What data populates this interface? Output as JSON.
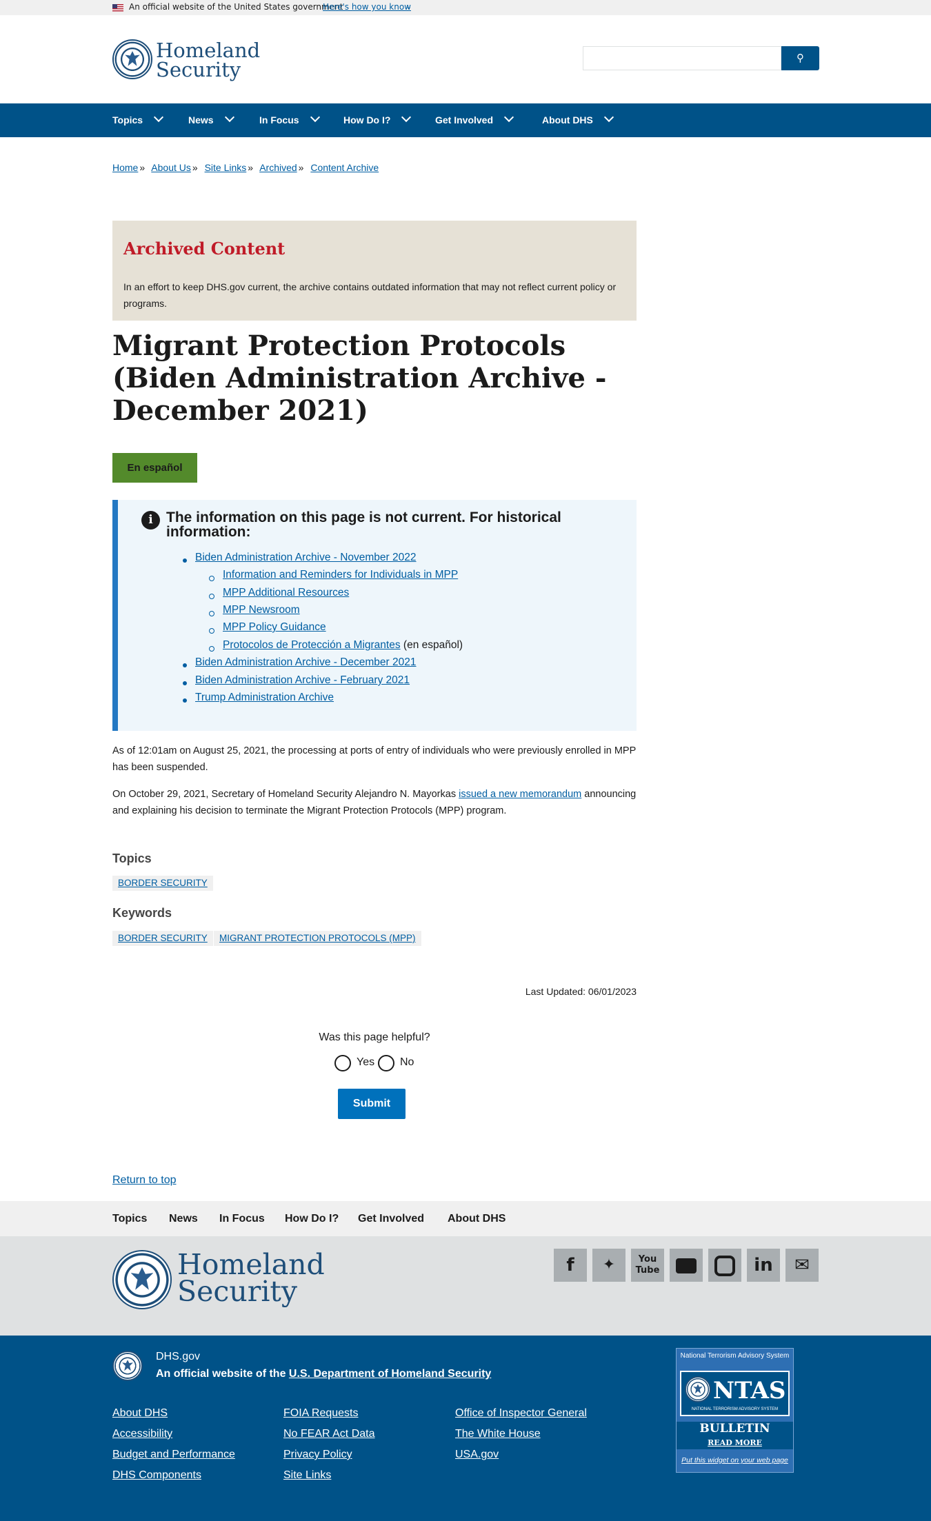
{
  "gov_banner": {
    "text": "An official website of the United States government",
    "link": "Here's how you know"
  },
  "logo": {
    "line1": "Homeland",
    "line2": "Security"
  },
  "search": {
    "placeholder": ""
  },
  "nav": [
    "Topics",
    "News",
    "In Focus",
    "How Do I?",
    "Get Involved",
    "About DHS"
  ],
  "breadcrumbs": [
    "Home",
    "About Us",
    "Site Links",
    "Archived",
    "Content Archive"
  ],
  "archived": {
    "title": "Archived Content",
    "text": "In an effort to keep DHS.gov current, the archive contains outdated information that may not reflect current policy or programs."
  },
  "page_title": "Migrant Protection Protocols (Biden Administration Archive - December 2021)",
  "espanol_button": "En español",
  "info_box": {
    "heading": "The information on this page is not current.  For historical information:",
    "items": [
      "Biden Administration Archive - November 2022",
      "Information and Reminders for Individuals in MPP",
      "MPP Additional Resources",
      "MPP Newsroom",
      "MPP Policy Guidance",
      "Protocolos de Protección a Migrantes",
      "(en español)",
      "Biden Administration Archive - December 2021",
      "Biden Administration Archive - February 2021",
      "Trump Administration Archive"
    ]
  },
  "body": {
    "p1": "As of 12:01am on August 25, 2021, the processing at ports of entry of individuals who were previously enrolled in MPP has been suspended.",
    "p2_a": "On October 29, 2021, Secretary of Homeland Security Alejandro N. Mayorkas ",
    "p2_link": "issued a new memorandum",
    "p2_b": " announcing and explaining his decision to terminate the Migrant Protection Protocols (MPP) program."
  },
  "topics": {
    "heading": "Topics",
    "tags": [
      "BORDER SECURITY"
    ]
  },
  "keywords": {
    "heading": "Keywords",
    "tags": [
      "BORDER SECURITY",
      "MIGRANT PROTECTION PROTOCOLS (MPP)"
    ]
  },
  "last_updated": "Last Updated: 06/01/2023",
  "feedback": {
    "question": "Was this page helpful?",
    "yes": "Yes",
    "no": "No",
    "submit": "Submit"
  },
  "return_to_top": "Return to top",
  "footer_nav": [
    "Topics",
    "News",
    "In Focus",
    "How Do I?",
    "Get Involved",
    "About DHS"
  ],
  "social_icons": [
    "facebook-icon",
    "twitter-icon",
    "youtube-icon",
    "flickr-icon",
    "instagram-icon",
    "linkedin-icon",
    "email-icon"
  ],
  "footer": {
    "site": "DHS.gov",
    "official_prefix": "An official website of the ",
    "official_link": "U.S. Department of Homeland Security",
    "links_col1": [
      "About DHS",
      "Accessibility",
      "Budget and Performance",
      "DHS Components"
    ],
    "links_col2": [
      "FOIA Requests",
      "No FEAR Act Data",
      "Privacy Policy",
      "Site Links"
    ],
    "links_col3": [
      "Office of Inspector General",
      "The White House",
      "USA.gov"
    ]
  },
  "ntas": {
    "top": "National Terrorism Advisory System",
    "word": "NTAS",
    "sub": "NATIONAL TERRORISM ADVISORY SYSTEM",
    "bulletin": "BULLETIN",
    "read_more": "READ MORE",
    "widget": "Put this widget on your web page"
  },
  "colors": {
    "nav_bg": "#005288",
    "link": "#005ea2",
    "archived_title": "#c01b28",
    "espanol_bg": "#538a2b",
    "info_border": "#2378c3"
  }
}
